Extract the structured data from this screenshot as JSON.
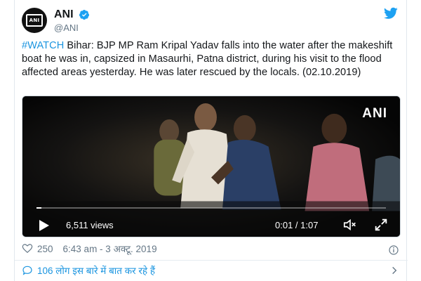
{
  "account": {
    "display_name": "ANI",
    "handle": "@ANI",
    "avatar_text": "ANI"
  },
  "tweet": {
    "hashtag": "#WATCH",
    "text": " Bihar: BJP MP Ram Kripal Yadav falls into the water after the makeshift boat he was in, capsized in Masaurhi, Patna district, during his visit to the flood affected areas yesterday. He was later rescued by the locals. (02.10.2019)"
  },
  "video": {
    "watermark": "ANI",
    "views": "6,511 views",
    "time": "0:01 / 1:07",
    "progress_fraction": 0.015
  },
  "meta": {
    "likes": "250",
    "timestamp": "6:43 am - 3 अक्टू. 2019"
  },
  "conversation": {
    "label": "106 लोग इस बारे में बात कर रहे हैं"
  },
  "colors": {
    "link": "#1b95e0",
    "verified": "#1da1f2",
    "muted": "#657786"
  },
  "icons": [
    "verified-badge-icon",
    "twitter-bird-icon",
    "play-icon",
    "volume-icon",
    "fullscreen-icon",
    "heart-icon",
    "info-icon",
    "speech-bubble-icon",
    "chevron-right-icon"
  ]
}
